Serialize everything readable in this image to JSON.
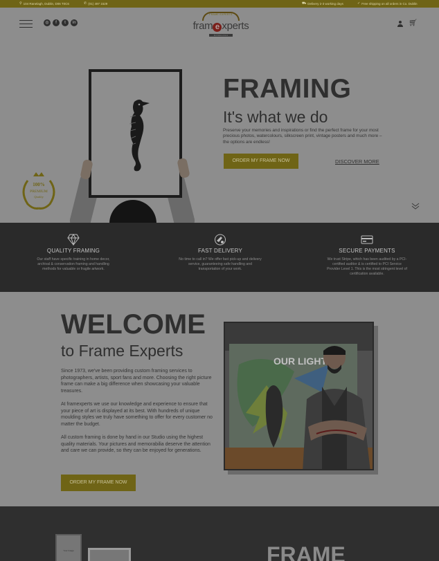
{
  "topbar": {
    "address": "104 Ranelagh, Dublin, D06 T0C6",
    "phone": "(01) 497 1529",
    "delivery": "Delivery 2-3 working days",
    "shipping": "Free shipping on all orders in Co. Dublin"
  },
  "header": {
    "logo_arc": "FRAME EXPERTS",
    "logo_word_a": "fram",
    "logo_word_e": "e",
    "logo_word_b": "xperts",
    "logo_sub": "RANELAGH",
    "social_icons": [
      "instagram-icon",
      "facebook-icon",
      "twitter-icon",
      "linkedin-icon"
    ],
    "social_glyphs": [
      "◎",
      "f",
      "t",
      "in"
    ]
  },
  "hero": {
    "title": "FRAMING",
    "subtitle": "It's what we do",
    "description": "Preserve your memories and inspirations or find the perfect frame for your most precious photos, watercolours, silkscreen print, vintage posters and much more – the options are endless!",
    "cta": "ORDER MY FRAME NOW",
    "discover": "DISCOVER MORE",
    "badge_top": "100%",
    "badge_mid": "PREMIUM",
    "badge_bottom": "Quality"
  },
  "features": [
    {
      "icon": "diamond-icon",
      "title": "QUALITY FRAMING",
      "text": "Our staff have specific training in home decor, archival & conservation framing and handling methods for valuable or fragile artwork."
    },
    {
      "icon": "delivery-icon",
      "title": "FAST DELIVERY",
      "text": "No time to call in? We offer fast pick-up and delivery service, guaranteeing safe handling and transportation of your work."
    },
    {
      "icon": "card-icon",
      "title": "SECURE PAYMENTS",
      "text": "We trust Stripe, which has been audited by a PCI-certified auditor & is certified to PCI Service Provider Level 1. This is the most stringent level of certification available."
    }
  ],
  "welcome": {
    "title": "WELCOME",
    "subtitle": "to Frame Experts",
    "p1": "Since 1973, we've been providing custom framing services to photographers, artists, sport fans and more. Choosing the right picture frame can make a big difference when showcasing your valuable treasures.",
    "p2": "At framexperts we use our knowledge and experience to ensure that your piece of art is displayed at its best. With hundreds of unique moulding styles we truly have something to offer for every customer no matter the budget.",
    "p3": "All custom framing is done by hand in our Studio using the highest quality materials. Your pictures and memorabilia deserve the attention and care we can provide, so they can be enjoyed for generations.",
    "cta": "ORDER MY FRAME NOW",
    "mural_text": "OUR LIGHT"
  },
  "bottom": {
    "title": "FRAME",
    "frame_label": "Your Image"
  }
}
